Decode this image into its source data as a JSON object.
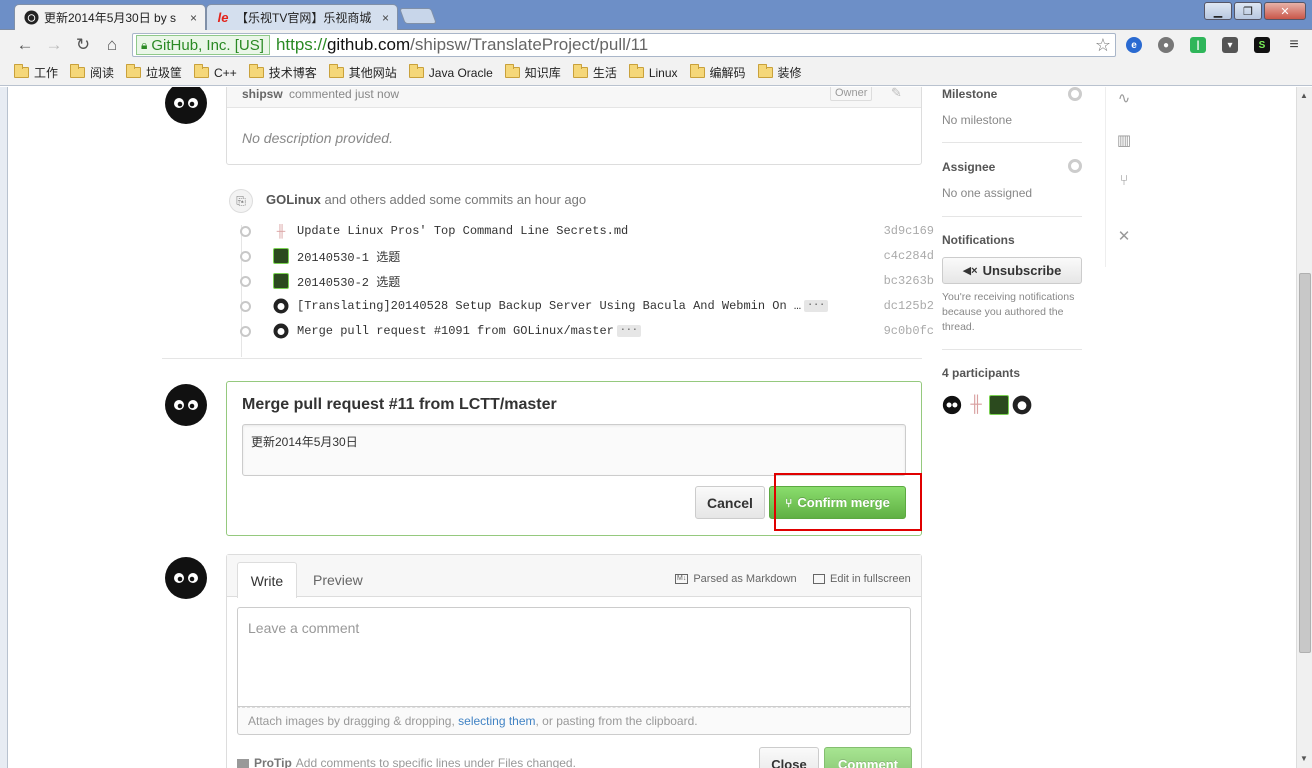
{
  "browser": {
    "tabs": [
      {
        "title": "更新2014年5月30日 by s",
        "close": "×"
      },
      {
        "title": "【乐视TV官网】乐视商城",
        "close": "×"
      }
    ],
    "address": {
      "ev_label": "GitHub, Inc. [US]",
      "scheme": "https://",
      "host": "github.com",
      "path": "/shipsw/TranslateProject/pull/11"
    },
    "bookmarks": [
      "工作",
      "阅读",
      "垃圾筐",
      "C++",
      "技术博客",
      "其他网站",
      "Java Oracle",
      "知识库",
      "生活",
      "Linux",
      "编解码",
      "装修"
    ]
  },
  "comment": {
    "author": "shipsw",
    "action": "commented just now",
    "badge": "Owner",
    "body": "No description provided."
  },
  "commits_event": {
    "author": "GOLinux",
    "text": "and others added some commits an hour ago",
    "commits": [
      {
        "message": "Update Linux Pros' Top Command Line Secrets.md",
        "sha": "3d9c169",
        "more": ""
      },
      {
        "message": "20140530-1 选题",
        "sha": "c4c284d",
        "more": ""
      },
      {
        "message": "20140530-2 选题",
        "sha": "bc3263b",
        "more": ""
      },
      {
        "message": "[Translating]20140528 Setup Backup Server Using Bacula And Webmin On …",
        "sha": "dc125b2",
        "more": "···"
      },
      {
        "message": "Merge pull request #1091 from GOLinux/master",
        "sha": "9c0b0fc",
        "more": "···"
      }
    ]
  },
  "merge": {
    "title": "Merge pull request #11 from LCTT/master",
    "message": "更新2014年5月30日",
    "cancel": "Cancel",
    "confirm": "Confirm merge"
  },
  "new_comment": {
    "tabs": [
      "Write",
      "Preview"
    ],
    "parsed": "Parsed as Markdown",
    "fullscreen": "Edit in fullscreen",
    "placeholder": "Leave a comment",
    "attach_prefix": "Attach images by dragging & dropping, ",
    "attach_link": "selecting them",
    "attach_suffix": ", or pasting from the clipboard.",
    "protip_label": "ProTip",
    "protip_text": "Add comments to specific lines under Files changed.",
    "close": "Close",
    "comment": "Comment"
  },
  "sidebar": {
    "milestone_heading": "Milestone",
    "milestone_value": "No milestone",
    "assignee_heading": "Assignee",
    "assignee_value": "No one assigned",
    "notifications_heading": "Notifications",
    "unsubscribe": "Unsubscribe",
    "notification_reason": [
      "You're receiving notifications",
      "because you authored the",
      "thread."
    ],
    "participants": "4 participants"
  },
  "colors": {
    "accent_green": "#6cc644",
    "link_blue": "#4183c4",
    "highlight_red": "#e00000"
  }
}
